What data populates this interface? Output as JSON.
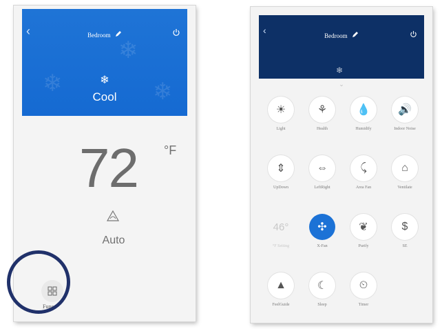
{
  "left_screen": {
    "room_title": "Bedroom",
    "mode_label": "Cool",
    "temperature": "72",
    "temp_unit": "°F",
    "fan_label": "Auto",
    "func_label": "Func"
  },
  "right_screen": {
    "room_title": "Bedroom",
    "functions": [
      {
        "label": "Light",
        "icon": "light-icon"
      },
      {
        "label": "Health",
        "icon": "health-icon"
      },
      {
        "label": "Humidify",
        "icon": "humidify-icon"
      },
      {
        "label": "Indoor Noise",
        "icon": "sound-icon"
      },
      {
        "label": "UpDown",
        "icon": "updown-swing-icon"
      },
      {
        "label": "LeftRight",
        "icon": "leftright-swing-icon"
      },
      {
        "label": "Area Fan",
        "icon": "area-fan-icon"
      },
      {
        "label": "Ventilate",
        "icon": "ventilate-icon"
      },
      {
        "label": "°F Setting",
        "icon": "temp-setting-icon",
        "value": "46°"
      },
      {
        "label": "X-Fan",
        "icon": "xfan-icon"
      },
      {
        "label": "Purify",
        "icon": "purify-icon"
      },
      {
        "label": "SE",
        "icon": "saving-icon",
        "value": "$"
      },
      {
        "label": "FeelGuide",
        "icon": "feel-icon"
      },
      {
        "label": "Sleep",
        "icon": "sleep-icon"
      },
      {
        "label": "Timer",
        "icon": "timer-icon"
      }
    ]
  },
  "colors": {
    "cool_blue": "#156ad2",
    "navy": "#0d3066",
    "highlight_ring": "#20316a",
    "active_button": "#1c72d6"
  }
}
